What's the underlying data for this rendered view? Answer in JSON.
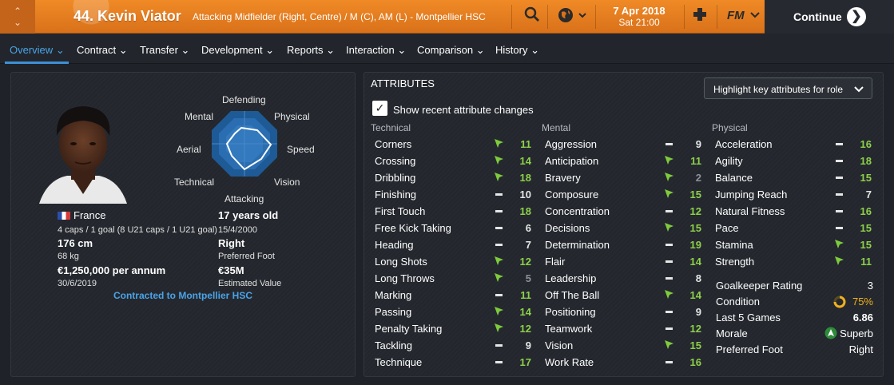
{
  "header": {
    "player_name": "44. Kevin Viator",
    "position_line": "Attacking Midfielder (Right, Centre) / M (C), AM (L) - Montpellier HSC",
    "date": "7 Apr 2018",
    "time": "Sat 21:00",
    "continue_label": "Continue",
    "fm_label": "FM"
  },
  "tabs": [
    {
      "label": "Overview"
    },
    {
      "label": "Contract"
    },
    {
      "label": "Transfer"
    },
    {
      "label": "Development"
    },
    {
      "label": "Reports"
    },
    {
      "label": "Interaction"
    },
    {
      "label": "Comparison"
    },
    {
      "label": "History"
    }
  ],
  "profile": {
    "radar_labels": {
      "defending": "Defending",
      "physical": "Physical",
      "speed": "Speed",
      "vision": "Vision",
      "attacking": "Attacking",
      "technical": "Technical",
      "aerial": "Aerial",
      "mental": "Mental"
    },
    "nationality": "France",
    "caps": "4 caps / 1 goal (8 U21 caps / 1 U21 goal)",
    "height": "176 cm",
    "weight": "68 kg",
    "wage": "€1,250,000 per annum",
    "contract_end": "30/6/2019",
    "age": "17 years old",
    "dob": "15/4/2000",
    "preferred_foot": "Right",
    "preferred_foot_label": "Preferred Foot",
    "value": "€35M",
    "value_label": "Estimated Value",
    "contracted_to": "Contracted to Montpellier HSC"
  },
  "attributes": {
    "title": "ATTRIBUTES",
    "highlight_dropdown": "Highlight key attributes for role",
    "show_changes_label": "Show recent attribute changes",
    "show_changes_checked": true,
    "technical_header": "Technical",
    "mental_header": "Mental",
    "physical_header": "Physical",
    "technical": [
      {
        "name": "Corners",
        "trend": "up",
        "value": "11"
      },
      {
        "name": "Crossing",
        "trend": "up",
        "value": "14"
      },
      {
        "name": "Dribbling",
        "trend": "up",
        "value": "18"
      },
      {
        "name": "Finishing",
        "trend": "flat",
        "value": "10"
      },
      {
        "name": "First Touch",
        "trend": "flat",
        "value": "18"
      },
      {
        "name": "Free Kick Taking",
        "trend": "flat",
        "value": "6"
      },
      {
        "name": "Heading",
        "trend": "flat",
        "value": "7"
      },
      {
        "name": "Long Shots",
        "trend": "up",
        "value": "12"
      },
      {
        "name": "Long Throws",
        "trend": "up",
        "value": "5"
      },
      {
        "name": "Marking",
        "trend": "flat",
        "value": "11"
      },
      {
        "name": "Passing",
        "trend": "up",
        "value": "14"
      },
      {
        "name": "Penalty Taking",
        "trend": "up",
        "value": "12"
      },
      {
        "name": "Tackling",
        "trend": "flat",
        "value": "9"
      },
      {
        "name": "Technique",
        "trend": "flat",
        "value": "17"
      }
    ],
    "mental": [
      {
        "name": "Aggression",
        "trend": "flat",
        "value": "9"
      },
      {
        "name": "Anticipation",
        "trend": "up",
        "value": "11"
      },
      {
        "name": "Bravery",
        "trend": "up",
        "value": "2"
      },
      {
        "name": "Composure",
        "trend": "up",
        "value": "15"
      },
      {
        "name": "Concentration",
        "trend": "flat",
        "value": "12"
      },
      {
        "name": "Decisions",
        "trend": "up",
        "value": "15"
      },
      {
        "name": "Determination",
        "trend": "flat",
        "value": "19"
      },
      {
        "name": "Flair",
        "trend": "flat",
        "value": "14"
      },
      {
        "name": "Leadership",
        "trend": "flat",
        "value": "8"
      },
      {
        "name": "Off The Ball",
        "trend": "up",
        "value": "14"
      },
      {
        "name": "Positioning",
        "trend": "flat",
        "value": "9"
      },
      {
        "name": "Teamwork",
        "trend": "flat",
        "value": "12"
      },
      {
        "name": "Vision",
        "trend": "up",
        "value": "15"
      },
      {
        "name": "Work Rate",
        "trend": "flat",
        "value": "16"
      }
    ],
    "physical": [
      {
        "name": "Acceleration",
        "trend": "flat",
        "value": "16"
      },
      {
        "name": "Agility",
        "trend": "flat",
        "value": "18"
      },
      {
        "name": "Balance",
        "trend": "flat",
        "value": "15"
      },
      {
        "name": "Jumping Reach",
        "trend": "flat",
        "value": "7"
      },
      {
        "name": "Natural Fitness",
        "trend": "flat",
        "value": "16"
      },
      {
        "name": "Pace",
        "trend": "flat",
        "value": "15"
      },
      {
        "name": "Stamina",
        "trend": "up",
        "value": "15"
      },
      {
        "name": "Strength",
        "trend": "up",
        "value": "11"
      }
    ],
    "extra": [
      {
        "name": "Goalkeeper Rating",
        "value": "3"
      },
      {
        "name": "Condition",
        "value": "75%"
      },
      {
        "name": "Last 5 Games",
        "value": "6.86"
      },
      {
        "name": "Morale",
        "value": "Superb"
      },
      {
        "name": "Preferred Foot",
        "value": "Right"
      }
    ]
  },
  "colors": {
    "accent": "#f08a26",
    "tab_active": "#4aa3e8",
    "highlight_green": "#8ed04a"
  }
}
